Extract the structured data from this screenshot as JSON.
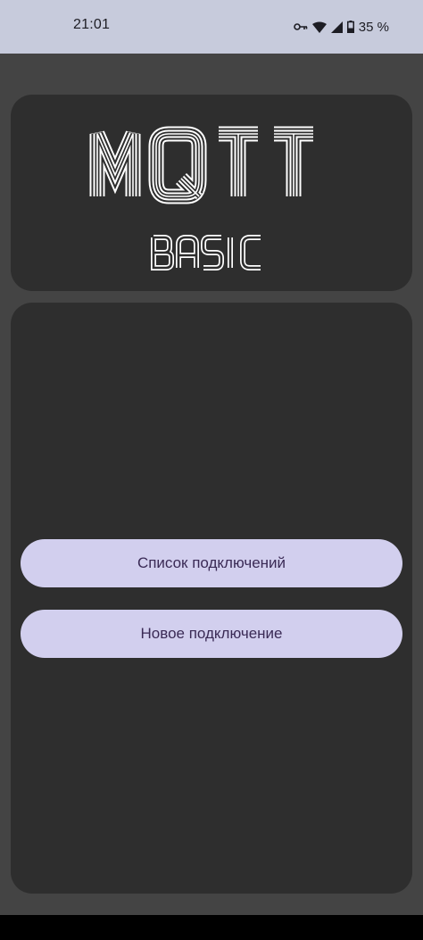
{
  "status_bar": {
    "time": "21:01",
    "battery_text": "35 %",
    "icons": [
      "vpn-key-icon",
      "wifi-icon",
      "signal-icon",
      "battery-icon"
    ]
  },
  "logo": {
    "title": "MQTT",
    "subtitle": "BASIC"
  },
  "menu": {
    "connections_list_label": "Список подключений",
    "new_connection_label": "Новое подключение"
  },
  "colors": {
    "status_bar_bg": "#c7cbdc",
    "screen_bg": "#444444",
    "card_bg": "#2e2e2e",
    "button_bg": "#d2cfee",
    "button_text": "#3a2a55"
  }
}
